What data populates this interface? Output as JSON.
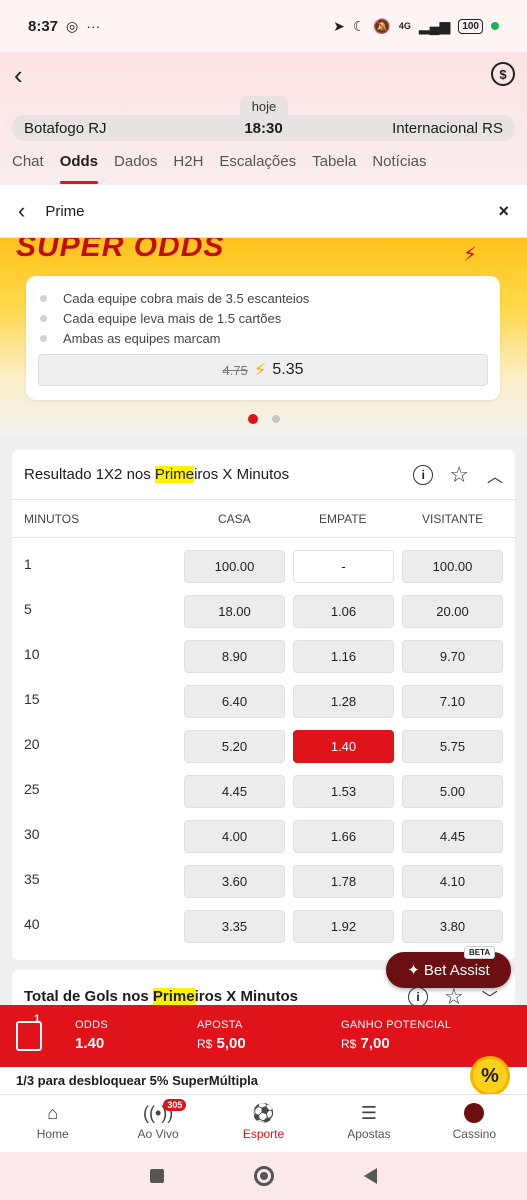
{
  "status_bar": {
    "time": "8:37",
    "battery": "100",
    "network": "4G"
  },
  "match": {
    "date": "hoje",
    "home": "Botafogo RJ",
    "kickoff": "18:30",
    "away": "Internacional RS"
  },
  "tabs": [
    {
      "label": "Chat",
      "active": false
    },
    {
      "label": "Odds",
      "active": true
    },
    {
      "label": "Dados",
      "active": false
    },
    {
      "label": "H2H",
      "active": false
    },
    {
      "label": "Escalações",
      "active": false
    },
    {
      "label": "Tabela",
      "active": false
    },
    {
      "label": "Notícias",
      "active": false
    }
  ],
  "subheader": {
    "title": "Prime",
    "close": "×"
  },
  "banner": {
    "title": "SUPER ODDS",
    "legs": [
      "Cada equipe cobra mais de 3.5 escanteios",
      "Cada equipe leva mais de 1.5 cartões",
      "Ambas as equipes marcam"
    ],
    "old_odds": "4.75",
    "new_odds": "5.35",
    "carousel_pages": 2,
    "carousel_active": 0
  },
  "market": {
    "title_pre": "Resultado 1X2 nos ",
    "title_hl": "Prime",
    "title_post": "iros X Minutos",
    "columns": {
      "minutes": "MINUTOS",
      "home": "CASA",
      "draw": "EMPATE",
      "away": "VISITANTE"
    },
    "rows": [
      {
        "min": "1",
        "home": "100.00",
        "draw": "-",
        "away": "100.00"
      },
      {
        "min": "5",
        "home": "18.00",
        "draw": "1.06",
        "away": "20.00"
      },
      {
        "min": "10",
        "home": "8.90",
        "draw": "1.16",
        "away": "9.70"
      },
      {
        "min": "15",
        "home": "6.40",
        "draw": "1.28",
        "away": "7.10"
      },
      {
        "min": "20",
        "home": "5.20",
        "draw": "1.40",
        "away": "5.75"
      },
      {
        "min": "25",
        "home": "4.45",
        "draw": "1.53",
        "away": "5.00"
      },
      {
        "min": "30",
        "home": "4.00",
        "draw": "1.66",
        "away": "4.45"
      },
      {
        "min": "35",
        "home": "3.60",
        "draw": "1.78",
        "away": "4.10"
      },
      {
        "min": "40",
        "home": "3.35",
        "draw": "1.92",
        "away": "3.80"
      }
    ],
    "selected": {
      "row": 4,
      "col": "draw"
    }
  },
  "market2": {
    "title_pre": "Total de Gols nos ",
    "title_hl": "Prime",
    "title_post": "iros X Minutos"
  },
  "bet_assist": {
    "label": "Bet Assist",
    "badge": "BETA"
  },
  "betslip": {
    "count": "1",
    "odds_label": "ODDS",
    "odds_value": "1.40",
    "stake_label": "APOSTA",
    "stake_currency": "R$",
    "stake_value": "5,00",
    "payout_label": "GANHO POTENCIAL",
    "payout_currency": "R$",
    "payout_value": "7,00"
  },
  "promo": {
    "text": "1/3 para desbloquear 5% SuperMúltipla",
    "badge": "%"
  },
  "bottom_nav": [
    {
      "label": "Home",
      "icon": "home-icon",
      "active": false
    },
    {
      "label": "Ao Vivo",
      "icon": "live-icon",
      "active": false,
      "badge": "305"
    },
    {
      "label": "Esporte",
      "icon": "soccer-ball-icon",
      "active": true
    },
    {
      "label": "Apostas",
      "icon": "receipt-icon",
      "active": false
    },
    {
      "label": "Cassino",
      "icon": "casino-icon",
      "active": false
    }
  ],
  "colors": {
    "brand_red": "#e0121a",
    "banner_yellow": "#ffc31a",
    "highlight": "#fff200",
    "bet_assist_bg": "#6b0f12"
  }
}
